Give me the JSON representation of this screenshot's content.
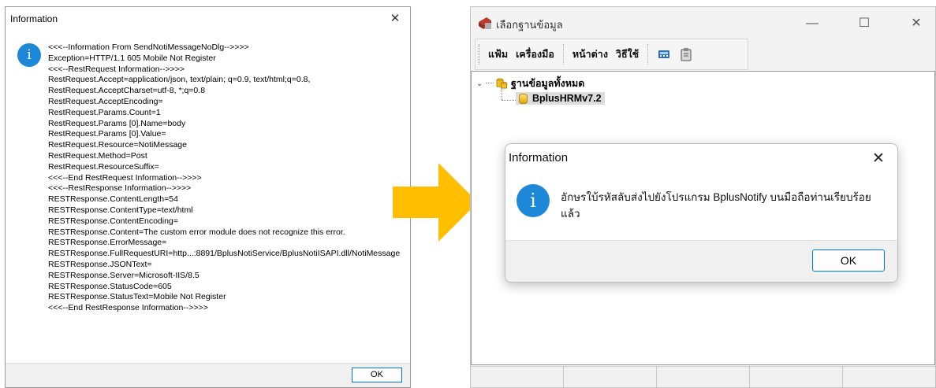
{
  "left_dialog": {
    "title": "Information",
    "close_glyph": "✕",
    "icon_glyph": "i",
    "ok_label": "OK",
    "lines": [
      "<<<--Information From SendNotiMessageNoDlg-->>>>",
      "Exception=HTTP/1.1 605 Mobile Not Register",
      "<<<--RestRequest Information-->>>>",
      "RestRequest.Accept=application/json, text/plain; q=0.9, text/html;q=0.8,",
      "RestRequest.AcceptCharset=utf-8, *;q=0.8",
      "RestRequest.AcceptEncoding=",
      "RestRequest.Params.Count=1",
      "RestRequest.Params [0].Name=body",
      "RestRequest.Params [0].Value=",
      "RestRequest.Resource=NotiMessage",
      "RestRequest.Method=Post",
      "RestRequest.ResourceSuffix=",
      "<<<--End RestRequest Information-->>>>",
      "<<<--RestResponse Information-->>>>",
      "RESTResponse.ContentLength=54",
      "RESTResponse.ContentType=text/html",
      "RESTResponse.ContentEncoding=",
      "RESTResponse.Content=The custom error module does not recognize this error.",
      "RESTResponse.ErrorMessage=",
      "RESTResponse.FullRequestURI=http...:8891/BplusNotiService/BplusNotiISAPI.dll/NotiMessage",
      "RESTResponse.JSONText=",
      "RESTResponse.Server=Microsoft-IIS/8.5",
      "RESTResponse.StatusCode=605",
      "RESTResponse.StatusText=Mobile Not Register",
      "<<<--End RestResponse Information-->>>>"
    ]
  },
  "right_window": {
    "title": "เลือกฐานข้อมูล",
    "min_glyph": "—",
    "max_glyph": "☐",
    "close_glyph": "✕",
    "menu": [
      "แฟ้ม",
      "เครื่องมือ",
      "หน้าต่าง",
      "วิธีใช้"
    ],
    "tree": {
      "expander_glyph": "⌄",
      "root_label": "ฐานข้อมูลทั้งหมด",
      "child_label": "BplusHRMv7.2"
    }
  },
  "modal": {
    "title": "Information",
    "close_glyph": "✕",
    "icon_glyph": "i",
    "message": "อักษรใบ้รหัสลับส่งไปยังโปรแกรม BplusNotify บนมือถือท่านเรียบร้อยแล้ว",
    "ok_label": "OK"
  },
  "colors": {
    "info_blue": "#1e88d8",
    "arrow_yellow": "#ffbf00",
    "focus_border": "#0078d7"
  }
}
